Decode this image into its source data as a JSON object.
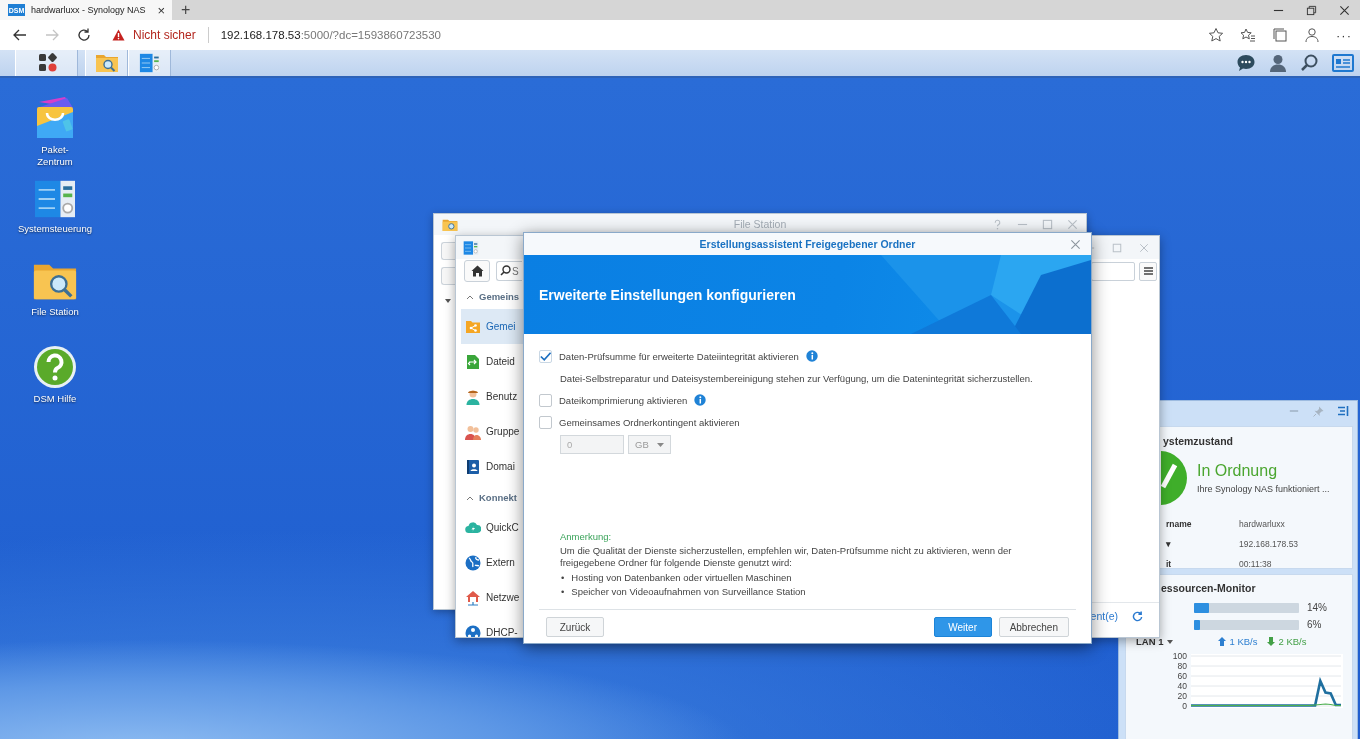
{
  "browser": {
    "tab": {
      "favicon": "DSM",
      "title": "hardwarluxx - Synology NAS",
      "close": "×"
    },
    "new_tab": "+",
    "forward_disabled": true,
    "security_warning": "Nicht sicher",
    "url_host": "192.168.178.53",
    "url_rest": ":5000/?dc=1593860723530",
    "menu": "···"
  },
  "taskbar": {
    "apps": [
      {
        "kind": "main-menu"
      },
      {
        "kind": "file-station"
      },
      {
        "kind": "control-panel"
      }
    ],
    "tray": [
      {
        "kind": "chat"
      },
      {
        "kind": "user"
      },
      {
        "kind": "search"
      },
      {
        "kind": "widgets"
      }
    ]
  },
  "desktop_icons": [
    {
      "kind": "package",
      "label": "Paket-Zentrum"
    },
    {
      "kind": "control-panel",
      "label": "Systemsteuerung"
    },
    {
      "kind": "file-station",
      "label": "File Station"
    },
    {
      "kind": "help",
      "label": "DSM Hilfe"
    }
  ],
  "file_station": {
    "title": "File Station"
  },
  "control_panel": {
    "search": {
      "placeholder": "S"
    },
    "sections": [
      {
        "label": "Gemeins",
        "expanded": true,
        "items": [
          {
            "label": "Gemei",
            "kind": "shared-folder",
            "selected": true
          },
          {
            "label": "Dateid",
            "kind": "file-services",
            "selected": false
          },
          {
            "label": "Benutz",
            "kind": "user",
            "selected": false
          },
          {
            "label": "Gruppe",
            "kind": "group",
            "selected": false
          },
          {
            "label": "Domai",
            "kind": "domain",
            "selected": false
          }
        ]
      },
      {
        "label": "Konnekt",
        "expanded": true,
        "items": [
          {
            "label": "QuickC",
            "kind": "quickconnect",
            "selected": false
          },
          {
            "label": "Extern",
            "kind": "external",
            "selected": false
          },
          {
            "label": "Netzwe",
            "kind": "network",
            "selected": false
          },
          {
            "label": "DHCP-",
            "kind": "dhcp",
            "selected": false
          }
        ]
      }
    ],
    "footer_link": "ent(e)"
  },
  "wizard": {
    "title": "Erstellungsassistent Freigegebener Ordner",
    "heading": "Erweiterte Einstellungen konfigurieren",
    "options": [
      {
        "label": "Daten-Prüfsumme für erweiterte Dateiintegrität aktivieren",
        "checked": true,
        "info": true,
        "description": "Datei-Selbstreparatur und Dateisystembereinigung stehen zur Verfügung, um die Datenintegrität sicherzustellen."
      },
      {
        "label": "Dateikomprimierung aktivieren",
        "checked": false,
        "info": true
      },
      {
        "label": "Gemeinsames Ordnerkontingent aktivieren",
        "checked": false,
        "info": false
      }
    ],
    "quota": {
      "value": "0",
      "unit": "GB",
      "disabled": true
    },
    "note": {
      "title": "Anmerkung:",
      "text": "Um die Qualität der Dienste sicherzustellen, empfehlen wir, Daten-Prüfsumme nicht zu aktivieren, wenn der freigegebene Ordner für folgende Dienste genutzt wird:",
      "marker": "•",
      "bullets": [
        "Hosting von Datenbanken oder virtuellen Maschinen",
        "Speicher von Videoaufnahmen von Surveillance Station"
      ]
    },
    "buttons": [
      {
        "label": "Zurück",
        "kind": "secondary"
      },
      {
        "label": "Weiter",
        "kind": "primary"
      },
      {
        "label": "Abbrechen",
        "kind": "secondary"
      }
    ]
  },
  "widgets": {
    "health": {
      "title": "ystemzustand",
      "status": "In Ordnung",
      "message": "Ihre Synology NAS funktioniert ...",
      "rows": [
        {
          "label": "rname",
          "value": "hardwarluxx"
        },
        {
          "label": "▾",
          "value": "192.168.178.53"
        },
        {
          "label": "it",
          "value": "00:11:38"
        }
      ]
    },
    "resources": {
      "title": "essourcen-Monitor",
      "meters": [
        {
          "level": 0.14,
          "reading": "14%"
        },
        {
          "level": 0.06,
          "reading": "6%"
        }
      ],
      "lan": "LAN 1",
      "upload": "1 KB/s",
      "download": "2 KB/s",
      "chart_data": {
        "type": "line",
        "grid": true,
        "ylim": [
          0,
          100
        ],
        "yticks": [
          0,
          20,
          40,
          60,
          80,
          100
        ],
        "series": [
          {
            "color": "#1f6f9f",
            "values": [
              1,
              1,
              1,
              1,
              1,
              1,
              1,
              1,
              1,
              1,
              1,
              1,
              1,
              1,
              1,
              1,
              1,
              1,
              1,
              1,
              1,
              1,
              1,
              1,
              1,
              50,
              27,
              25,
              2,
              2
            ]
          },
          {
            "color": "#4caf50",
            "values": [
              1,
              1,
              1,
              1,
              1,
              1,
              1,
              1,
              1,
              1,
              1,
              1,
              1,
              1,
              1,
              1,
              1,
              1,
              1,
              1,
              1,
              1,
              1,
              1,
              2,
              3,
              4,
              3,
              1,
              1
            ]
          }
        ]
      }
    }
  }
}
